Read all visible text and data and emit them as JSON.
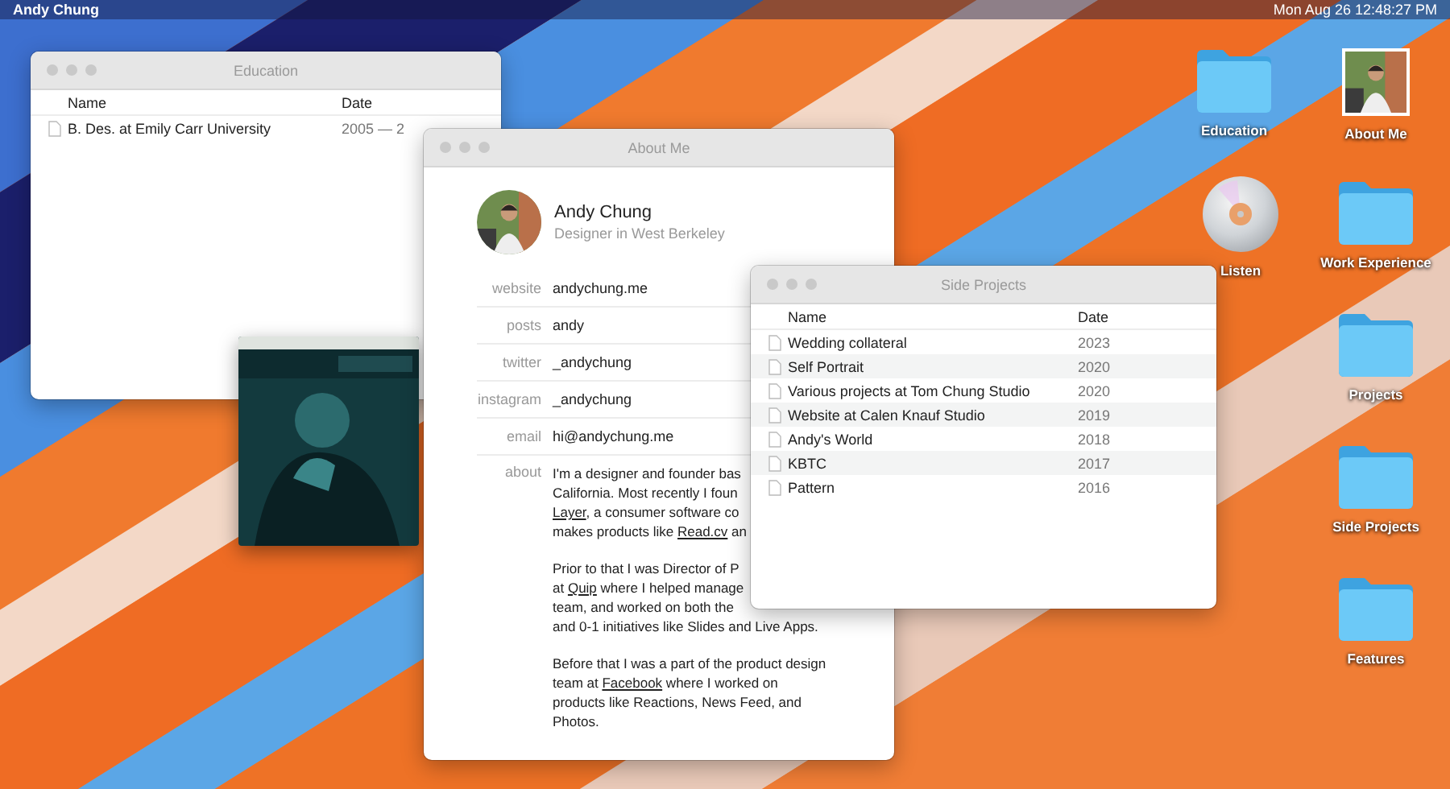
{
  "menu_bar": {
    "owner": "Andy Chung",
    "clock": "Mon Aug 26  12:48:27 PM"
  },
  "education_window": {
    "title": "Education",
    "columns": [
      "Name",
      "Date"
    ],
    "rows": [
      {
        "name": "B. Des. at Emily Carr University",
        "date": "2005 — 2"
      }
    ]
  },
  "about_window": {
    "title": "About Me",
    "name": "Andy Chung",
    "subtitle": "Designer in West Berkeley",
    "fields": [
      {
        "label": "website",
        "value": "andychung.me"
      },
      {
        "label": "posts",
        "value": "andy"
      },
      {
        "label": "twitter",
        "value": "_andychung"
      },
      {
        "label": "instagram",
        "value": "_andychung"
      },
      {
        "label": "email",
        "value": "hi@andychung.me"
      }
    ],
    "about_label": "about",
    "paragraphs": [
      {
        "lines": [
          [
            {
              "text": "I'm a designer and founder bas",
              "link": false
            }
          ],
          [
            {
              "text": "California. Most recently I foun",
              "link": false
            }
          ],
          [
            {
              "text": "Layer",
              "link": true
            },
            {
              "text": ", a consumer software co",
              "link": false
            }
          ],
          [
            {
              "text": "makes products like ",
              "link": false
            },
            {
              "text": "Read.cv",
              "link": true
            },
            {
              "text": " an",
              "link": false
            }
          ]
        ]
      },
      {
        "lines": [
          [
            {
              "text": "Prior to that I was Director of P",
              "link": false
            }
          ],
          [
            {
              "text": "at ",
              "link": false
            },
            {
              "text": "Quip",
              "link": true
            },
            {
              "text": " where I helped manage",
              "link": false
            }
          ],
          [
            {
              "text": "team, and worked on both the",
              "link": false
            }
          ],
          [
            {
              "text": "and 0-1 initiatives like Slides and Live Apps.",
              "link": false
            }
          ]
        ]
      },
      {
        "lines": [
          [
            {
              "text": "Before that I was a part of the product design",
              "link": false
            }
          ],
          [
            {
              "text": "team at ",
              "link": false
            },
            {
              "text": "Facebook",
              "link": true
            },
            {
              "text": " where I worked on",
              "link": false
            }
          ],
          [
            {
              "text": "products like Reactions, News Feed, and",
              "link": false
            }
          ],
          [
            {
              "text": "Photos.",
              "link": false
            }
          ]
        ]
      }
    ]
  },
  "side_projects_window": {
    "title": "Side Projects",
    "columns": [
      "Name",
      "Date"
    ],
    "rows": [
      {
        "name": "Wedding collateral",
        "date": "2023"
      },
      {
        "name": "Self Portrait",
        "date": "2020"
      },
      {
        "name": "Various projects at Tom Chung Studio",
        "date": "2020"
      },
      {
        "name": "Website at Calen Knauf Studio",
        "date": "2019"
      },
      {
        "name": "Andy's World",
        "date": "2018"
      },
      {
        "name": "KBTC",
        "date": "2017"
      },
      {
        "name": "Pattern",
        "date": "2016"
      }
    ]
  },
  "desktop_icons": [
    {
      "label": "Education",
      "kind": "folder"
    },
    {
      "label": "About Me"
    },
    {
      "label": "Listen",
      "kind": "disc"
    },
    {
      "label": "Work Experience",
      "kind": "folder"
    },
    {
      "label": "Projects",
      "kind": "folder"
    },
    {
      "label": "Side Projects",
      "kind": "folder"
    },
    {
      "label": "Features",
      "kind": "folder"
    }
  ]
}
